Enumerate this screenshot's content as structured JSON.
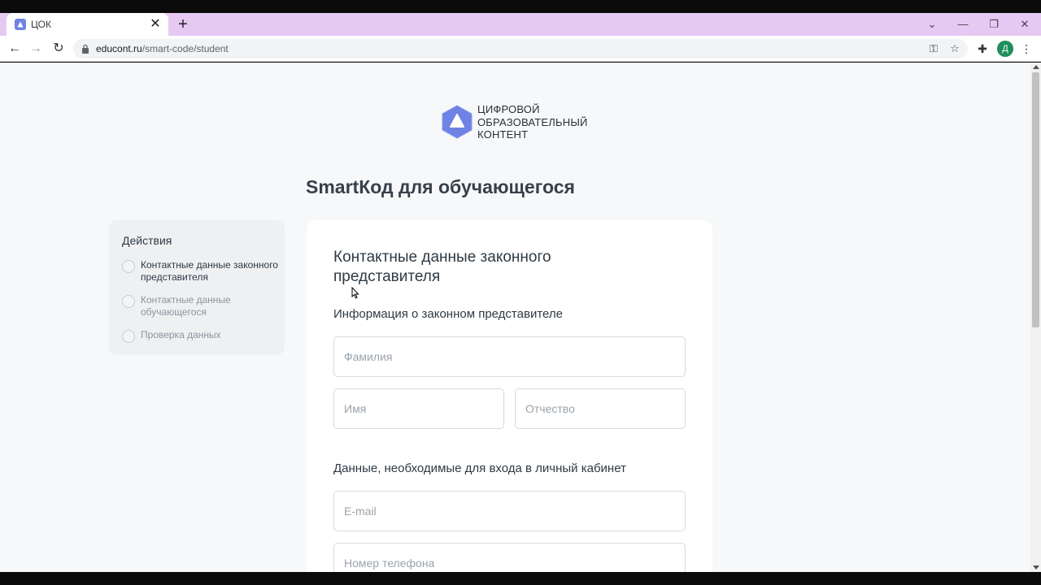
{
  "browser": {
    "tab_title": "ЦОК",
    "url_host": "educont.ru",
    "url_path": "/smart-code/student",
    "avatar_letter": "Д",
    "tab_bar_color": "#e6c9f3"
  },
  "logo": {
    "line1": "ЦИФРОВОЙ",
    "line2": "ОБРАЗОВАТЕЛЬНЫЙ",
    "line3": "КОНТЕНТ",
    "color": "#6f83e4"
  },
  "page": {
    "title": "SmartКод для обучающегося"
  },
  "steps": {
    "title": "Действия",
    "items": [
      {
        "label": "Контактные данные законного представителя",
        "active": true
      },
      {
        "label": "Контактные данные обучающегося",
        "active": false
      },
      {
        "label": "Проверка данных",
        "active": false
      }
    ]
  },
  "form": {
    "title": "Контактные данные законного представителя",
    "section1": "Информация о законном представителе",
    "section2": "Данные, необходимые для входа в личный кабинет",
    "fields": {
      "last_name": {
        "placeholder": "Фамилия",
        "value": ""
      },
      "first_name": {
        "placeholder": "Имя",
        "value": ""
      },
      "patronymic": {
        "placeholder": "Отчество",
        "value": ""
      },
      "email": {
        "placeholder": "E-mail",
        "value": ""
      },
      "phone": {
        "placeholder": "Номер телефона",
        "value": ""
      }
    }
  }
}
